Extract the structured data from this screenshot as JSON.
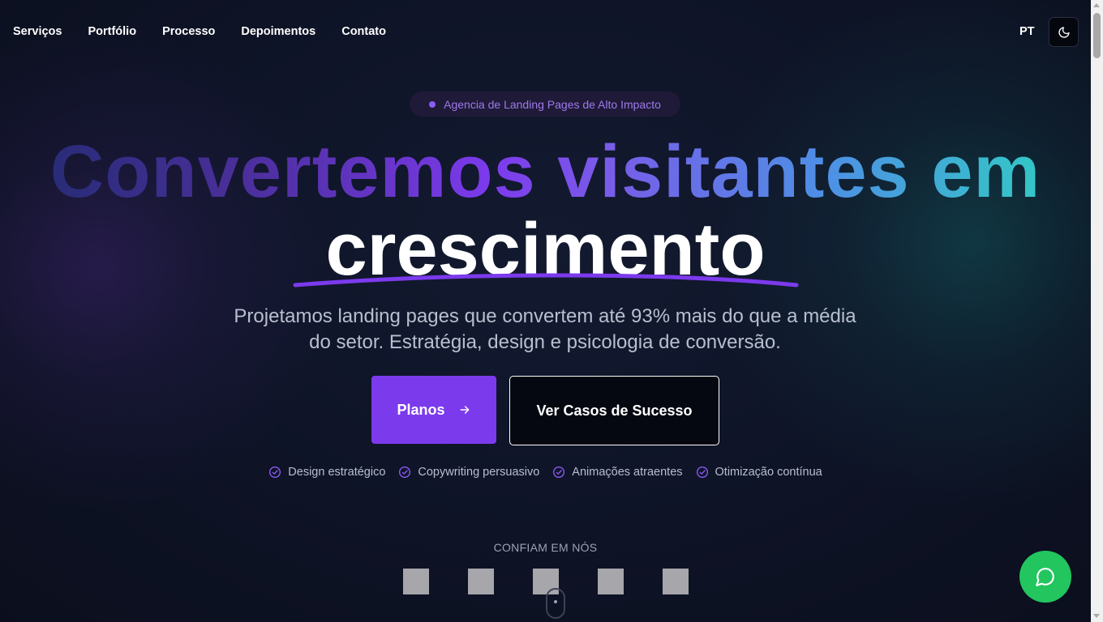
{
  "nav": {
    "links": [
      "Serviços",
      "Portfólio",
      "Processo",
      "Depoimentos",
      "Contato"
    ],
    "language": "PT",
    "theme_icon": "moon-icon"
  },
  "hero": {
    "badge": "Agencia de Landing Pages de Alto Impacto",
    "headline_line1": "Convertemos visitantes em",
    "headline_line2": "crescimento",
    "subtitle": "Projetamos landing pages que convertem até 93% mais do que a média do setor. Estratégia, design e psicologia de conversão.",
    "primary_button": "Planos",
    "secondary_button": "Ver Casos de Sucesso",
    "features": [
      "Design estratégico",
      "Copywriting persuasivo",
      "Animações atraentes",
      "Otimização contínua"
    ]
  },
  "trust": {
    "title": "CONFIAM EM NÓS",
    "logo_count": 5
  },
  "chat": {
    "icon": "whatsapp-chat-icon"
  },
  "colors": {
    "accent": "#7c3aed",
    "background": "#0c1020",
    "teal": "#2dd4bf",
    "chat": "#22c55e"
  }
}
